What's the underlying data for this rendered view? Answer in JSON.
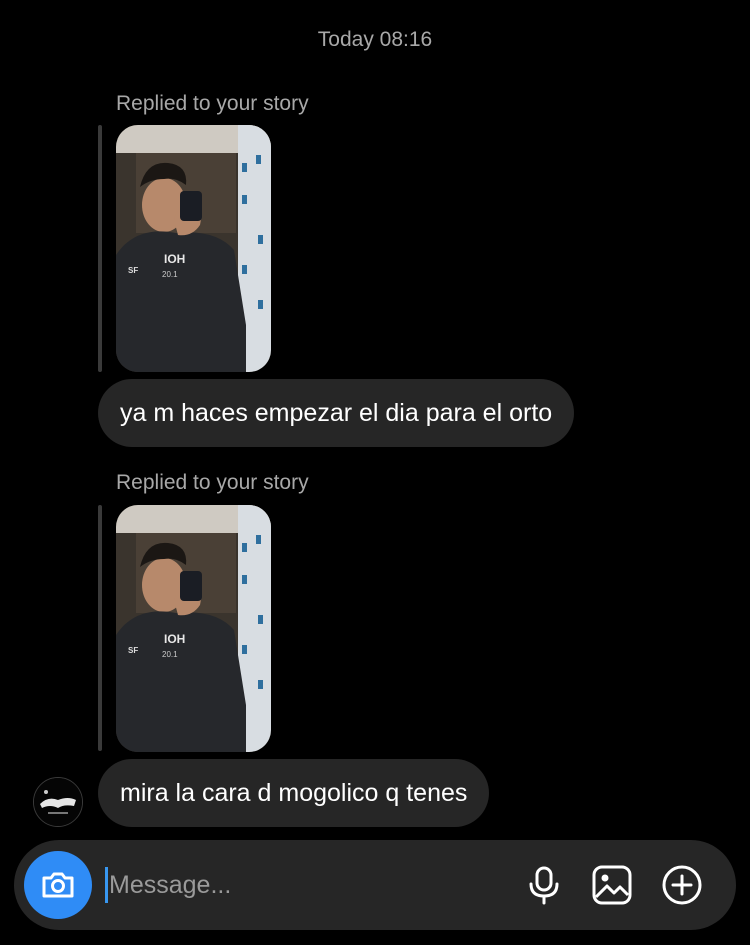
{
  "header": {
    "timestamp": "Today 08:16"
  },
  "messages": [
    {
      "reply_label": "Replied to your story",
      "story_thumbnail": "story-photo-mirror-selfie",
      "text": "ya m haces empezar el dia para el orto"
    },
    {
      "reply_label": "Replied to your story",
      "story_thumbnail": "story-photo-mirror-selfie",
      "text": "mira la cara d mogolico q tenes"
    }
  ],
  "sender": {
    "avatar": "sender-avatar-logo"
  },
  "composer": {
    "placeholder": "Message...",
    "value": "",
    "camera_icon": "camera-icon",
    "mic_icon": "microphone-icon",
    "gallery_icon": "gallery-icon",
    "more_icon": "plus-circle-icon"
  },
  "colors": {
    "background": "#000000",
    "bubble": "#262626",
    "secondary_text": "#a8a8a8",
    "accent": "#2f8cf6"
  }
}
